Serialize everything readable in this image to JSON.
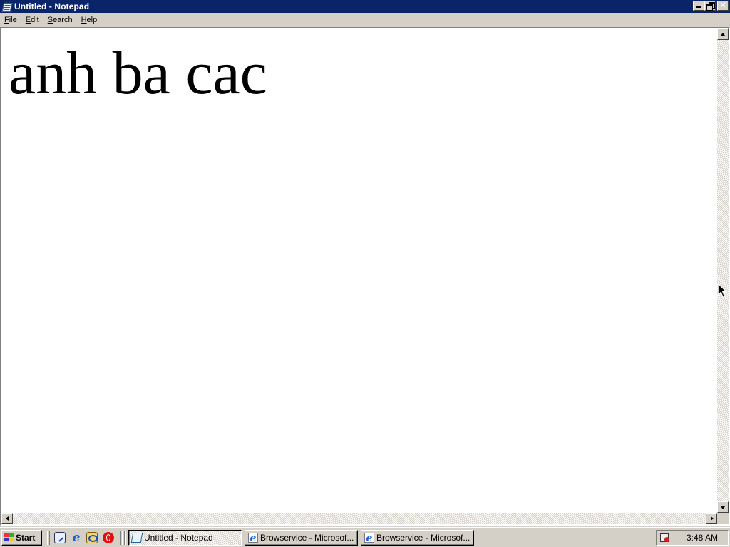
{
  "window": {
    "title": "Untitled - Notepad",
    "icon": "notepad-icon",
    "controls": {
      "minimize": "minimize-icon",
      "restore": "restore-icon",
      "close_glyph": "✕"
    }
  },
  "menu": {
    "items": [
      {
        "label": "File",
        "accel": "F",
        "rest": "ile"
      },
      {
        "label": "Edit",
        "accel": "E",
        "rest": "dit"
      },
      {
        "label": "Search",
        "accel": "S",
        "rest": "earch"
      },
      {
        "label": "Help",
        "accel": "H",
        "rest": "elp"
      }
    ]
  },
  "editor": {
    "content": "anh ba cac"
  },
  "taskbar": {
    "start_label": "Start",
    "quick_launch": [
      "show-desktop-icon",
      "internet-explorer-icon",
      "outlook-express-icon",
      "opera-icon"
    ],
    "tasks": [
      {
        "label": "Untitled - Notepad",
        "icon": "notepad-icon",
        "active": true
      },
      {
        "label": "Browservice - Microsof...",
        "icon": "internet-explorer-icon",
        "active": false
      },
      {
        "label": "Browservice - Microsof...",
        "icon": "internet-explorer-icon",
        "active": false
      }
    ],
    "tray": {
      "icons": [
        "scheduler-icon"
      ],
      "clock": "3:48 AM"
    }
  }
}
